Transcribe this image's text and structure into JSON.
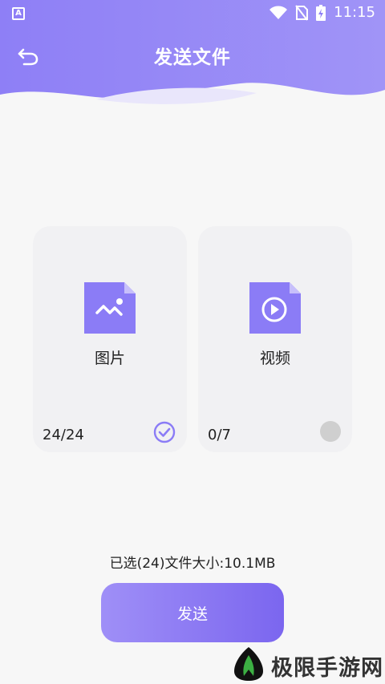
{
  "status_bar": {
    "time": "11:15"
  },
  "header": {
    "title": "发送文件"
  },
  "cards": [
    {
      "label": "图片",
      "count": "24/24",
      "selected": true
    },
    {
      "label": "视频",
      "count": "0/7",
      "selected": false
    }
  ],
  "summary": "已选(24)文件大小:10.1MB",
  "send_button_label": "发送",
  "watermark_text": "极限手游网",
  "colors": {
    "accent": "#8b7cf6",
    "header_start": "#8e7ff6",
    "header_end": "#a094f7",
    "background": "#f7f7f7",
    "card": "#f1f1f3"
  },
  "icons": [
    "back-arrow-icon",
    "image-file-icon",
    "video-file-icon",
    "check-circle-icon",
    "wifi-icon",
    "no-sim-icon",
    "battery-icon"
  ]
}
